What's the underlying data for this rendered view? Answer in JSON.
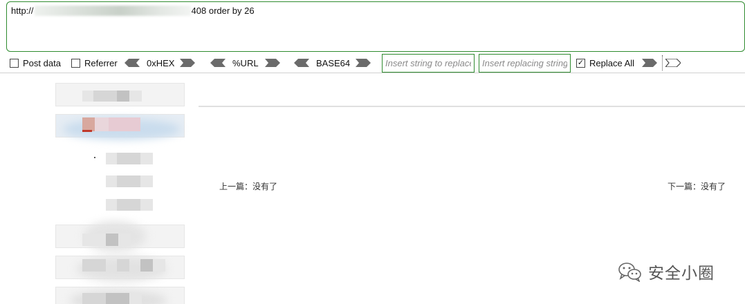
{
  "url_bar": {
    "prefix": "http://",
    "suffix": "408 order by 26"
  },
  "toolbar": {
    "post_data_label": "Post data",
    "post_data_checked": false,
    "referrer_label": "Referrer",
    "referrer_checked": false,
    "hex_label": "0xHEX",
    "url_label": "%URL",
    "base64_label": "BASE64",
    "insert_string_placeholder": "Insert string to replace",
    "insert_replacing_placeholder": "Insert replacing string",
    "replace_all_label": "Replace All",
    "replace_all_checked": true
  },
  "content": {
    "prev_label": "上一篇：没有了",
    "next_label": "下一篇：没有了"
  },
  "watermark": {
    "text": "安全小圈",
    "icon": "wechat-icon"
  },
  "colors": {
    "accent_border": "#2e8b2e",
    "arrow_fill": "#6b6b6b"
  }
}
